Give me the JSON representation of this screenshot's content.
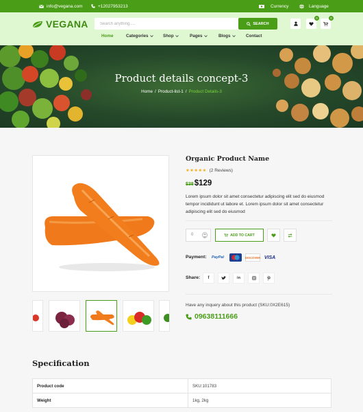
{
  "topbar": {
    "email": "info@vegana.com",
    "phone": "+12027953213",
    "currency": "Currency",
    "language": "Language"
  },
  "header": {
    "logo": "VEGANA",
    "search_placeholder": "Search anything.....",
    "search_button": "SEARCH",
    "wishlist_count": "0",
    "cart_count": "0"
  },
  "nav": {
    "home": "Home",
    "categories": "Categories",
    "shop": "Shop",
    "pages": "Pages",
    "blogs": "Blogs",
    "contact": "Contact"
  },
  "hero": {
    "title": "Product details concept-3",
    "crumb_home": "Home",
    "crumb_list": "Product-list-1",
    "crumb_current": "Product Details-3",
    "sep": "/"
  },
  "product": {
    "name": "Organic Product Name",
    "stars": "★★★★★",
    "reviews": "(2 Reviews)",
    "old_price": "$38",
    "price": "$129",
    "description": "Lorem ipsum dolor sit amet consectetur adipiscing elit sed do eiusmod tempor incididunt ut labore et. Lorem ipsum dolor sit amet consectetur adipiscing elit sed do eiusmod",
    "qty": "0",
    "add_to_cart": "ADD TO CART",
    "payment_label": "Payment:",
    "payments": [
      "PayPal",
      "Maestro",
      "DISCOVER",
      "VISA"
    ],
    "share_label": "Share:",
    "inquiry": "Have any inquery about this product (SKU:0X2E615)",
    "phone": "09638111666"
  },
  "spec": {
    "title": "Specification",
    "rows": [
      {
        "key": "Product code",
        "value": "SKU:101783"
      },
      {
        "key": "Weight",
        "value": "1kg, 2kg"
      }
    ]
  },
  "colors": {
    "brand_green": "#4a9d17",
    "header_bg": "#dff8d2",
    "star": "#f6b01e"
  }
}
